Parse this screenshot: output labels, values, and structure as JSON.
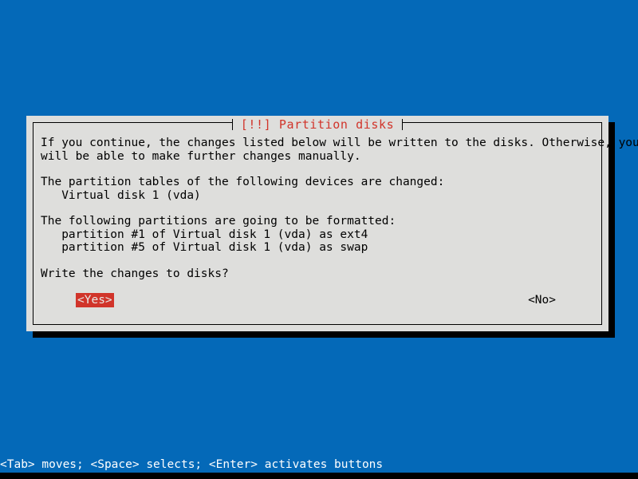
{
  "screen": {
    "background_color": "#0469b8"
  },
  "dialog": {
    "title": "[!!] Partition disks",
    "title_color": "#d1342a",
    "background_color": "#dededc",
    "paragraphs": {
      "intro_line1": "If you continue, the changes listed below will be written to the disks. Otherwise, you",
      "intro_line2": "will be able to make further changes manually.",
      "devices_heading": "The partition tables of the following devices are changed:",
      "device_item_1": "   Virtual disk 1 (vda)",
      "format_heading": "The following partitions are going to be formatted:",
      "format_item_1": "   partition #1 of Virtual disk 1 (vda) as ext4",
      "format_item_2": "   partition #5 of Virtual disk 1 (vda) as swap",
      "question": "Write the changes to disks?"
    },
    "buttons": {
      "yes_label": "<Yes>",
      "no_label": "<No>",
      "selected": "<Yes>",
      "highlight_color": "#d1342a",
      "highlight_text_color": "#e8e8e6"
    }
  },
  "footer": {
    "hint": "<Tab> moves; <Space> selects; <Enter> activates buttons",
    "text_color": "#ffffff",
    "background_color": "#0469b8"
  }
}
